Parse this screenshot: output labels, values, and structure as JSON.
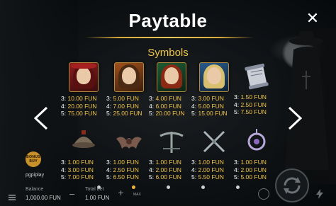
{
  "header": {
    "title": "Paytable",
    "close_label": "✕"
  },
  "section": {
    "title": "Symbols"
  },
  "symbols": [
    {
      "name": "red-hat-woman",
      "pays": [
        {
          "k": "3:",
          "v": "10.00 FUN"
        },
        {
          "k": "4:",
          "v": "20.00 FUN"
        },
        {
          "k": "5:",
          "v": "75.00 FUN"
        }
      ]
    },
    {
      "name": "hunter-woman",
      "pays": [
        {
          "k": "3:",
          "v": "5.00 FUN"
        },
        {
          "k": "4:",
          "v": "7.00 FUN"
        },
        {
          "k": "5:",
          "v": "25.00 FUN"
        }
      ]
    },
    {
      "name": "red-haired-woman",
      "pays": [
        {
          "k": "3:",
          "v": "4.00 FUN"
        },
        {
          "k": "4:",
          "v": "6.00 FUN"
        },
        {
          "k": "5:",
          "v": "20.00 FUN"
        }
      ]
    },
    {
      "name": "blonde-woman",
      "pays": [
        {
          "k": "3:",
          "v": "3.00 FUN"
        },
        {
          "k": "4:",
          "v": "5.00 FUN"
        },
        {
          "k": "5:",
          "v": "15.00 FUN"
        }
      ]
    },
    {
      "name": "scroll",
      "pays": [
        {
          "k": "3:",
          "v": "1.50 FUN"
        },
        {
          "k": "4:",
          "v": "2.50 FUN"
        },
        {
          "k": "5:",
          "v": "7.50 FUN"
        }
      ]
    },
    {
      "name": "helmet",
      "pays": [
        {
          "k": "3:",
          "v": "1.00 FUN"
        },
        {
          "k": "4:",
          "v": "3.00 FUN"
        },
        {
          "k": "5:",
          "v": "7.00 FUN"
        }
      ]
    },
    {
      "name": "bat",
      "pays": [
        {
          "k": "3:",
          "v": "1.00 FUN"
        },
        {
          "k": "4:",
          "v": "2.50 FUN"
        },
        {
          "k": "5:",
          "v": "6.50 FUN"
        }
      ]
    },
    {
      "name": "crossbow",
      "pays": [
        {
          "k": "3:",
          "v": "1.00 FUN"
        },
        {
          "k": "4:",
          "v": "2.00 FUN"
        },
        {
          "k": "5:",
          "v": "6.00 FUN"
        }
      ]
    },
    {
      "name": "crossed-blades",
      "pays": [
        {
          "k": "3:",
          "v": "1.00 FUN"
        },
        {
          "k": "4:",
          "v": "2.00 FUN"
        },
        {
          "k": "5:",
          "v": "5.50 FUN"
        }
      ]
    },
    {
      "name": "amulet",
      "pays": [
        {
          "k": "3:",
          "v": "1.00 FUN"
        },
        {
          "k": "4:",
          "v": "2.00 FUN"
        },
        {
          "k": "5:",
          "v": "5.00 FUN"
        }
      ]
    }
  ],
  "pagination": {
    "pages": 5,
    "active": 1
  },
  "footer": {
    "bonus_badge": "BONUS BUY",
    "brand": "pgpiplay",
    "balance_label": "Balance",
    "balance_value": "1,000.00 FUN",
    "total_bet_label": "Total bet",
    "total_bet_value": "1.00 FUN",
    "minus": "−",
    "plus": "+",
    "max_label": "MAX"
  },
  "colors": {
    "accent": "#f0c34a",
    "text": "#e6e6e6"
  }
}
